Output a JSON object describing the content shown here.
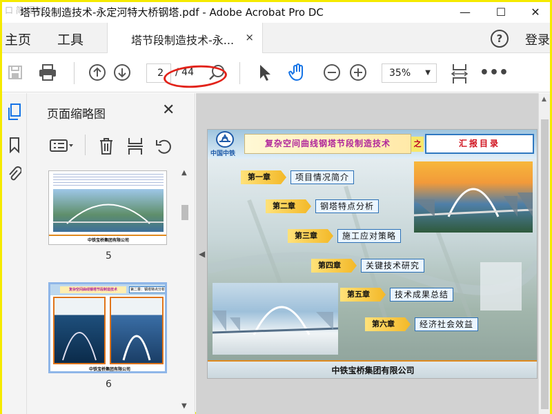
{
  "window": {
    "title": "塔节段制造技术-永定河特大桥钢塔.pdf - Adobe Acrobat Pro DC",
    "watermark": "口 简 逼制",
    "controls": [
      "—",
      "☐",
      "✕"
    ]
  },
  "tabs": {
    "home": "主页",
    "tools": "工具",
    "doc_tab": "塔节段制造技术-永...",
    "doc_tab_close": "×",
    "help": "?",
    "login": "登录"
  },
  "toolbar": {
    "page_current": "2",
    "page_total": "/ 44",
    "zoom": "35%"
  },
  "panel": {
    "title": "页面缩略图",
    "close": "✕",
    "thumbnails": [
      {
        "page": "5",
        "caption": "中铁宝桥集团有限公司"
      },
      {
        "page": "6",
        "caption": "中铁宝桥集团有限公司",
        "banner": "复杂空间曲线钢塔节段制造技术",
        "tag": "第二章：钢塔特点分析"
      }
    ]
  },
  "slide": {
    "logo_text": "中国中铁",
    "banner": "复杂空间曲线钢塔节段制造技术",
    "connector": "之",
    "section_title": "汇报目录",
    "chapters": [
      {
        "num": "第一章",
        "title": "项目情况简介"
      },
      {
        "num": "第二章",
        "title": "钢塔特点分析"
      },
      {
        "num": "第三章",
        "title": "施工应对策略"
      },
      {
        "num": "第四章",
        "title": "关键技术研究"
      },
      {
        "num": "第五章",
        "title": "技术成果总结"
      },
      {
        "num": "第六章",
        "title": "经济社会效益"
      }
    ],
    "footer": "中铁宝桥集团有限公司"
  },
  "colors": {
    "highlight_border": "#f5ea00",
    "annotation_red": "#e2231a",
    "banner_magenta": "#b0279b",
    "section_red": "#d0101c"
  }
}
